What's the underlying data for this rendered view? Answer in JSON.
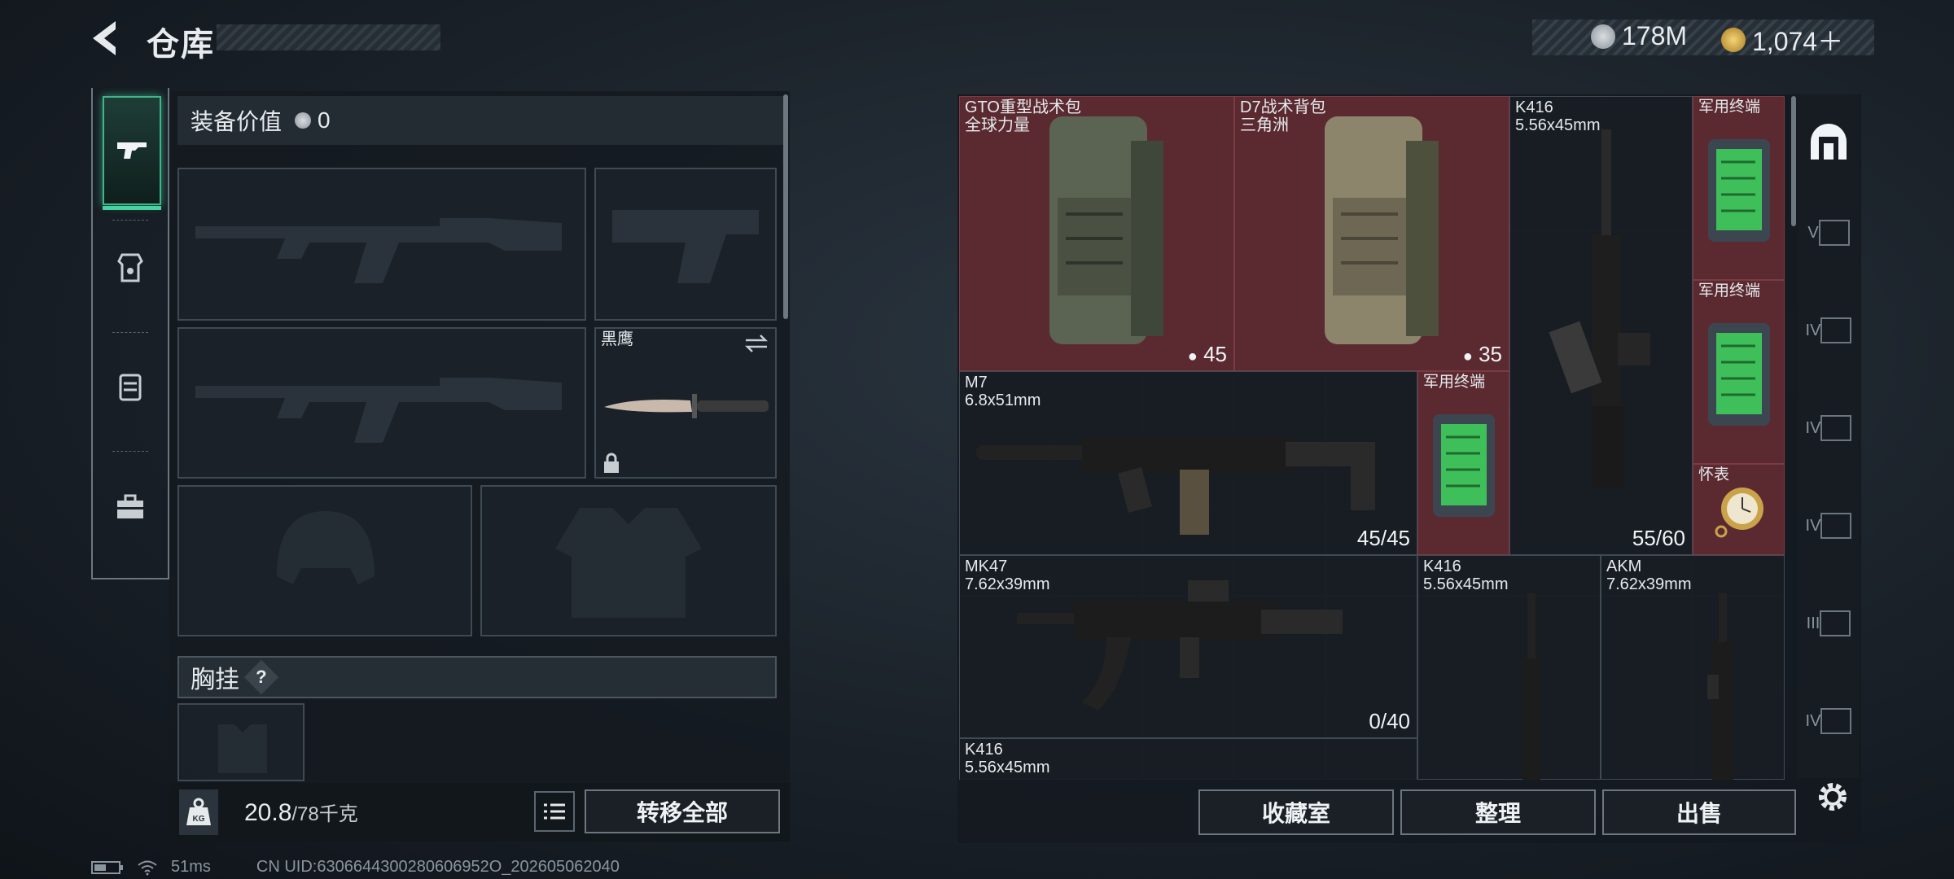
{
  "header": {
    "title": "仓库",
    "currency_silver": "178M",
    "currency_gold": "1,074＋"
  },
  "left_tabs": [
    {
      "name": "weapon-tab"
    },
    {
      "name": "armor-tab"
    },
    {
      "name": "backpack-tab"
    },
    {
      "name": "toolbox-tab"
    }
  ],
  "equipment": {
    "value_label": "装备价值",
    "value": "0",
    "secondary_slot_name": "黑鹰",
    "chest_label": "胸挂",
    "chest_help": "?"
  },
  "weight": {
    "current": "20.8",
    "max": "/78千克"
  },
  "buttons": {
    "transfer_all": "转移全部",
    "collection": "收藏室",
    "organize": "整理",
    "sell": "出售"
  },
  "status": {
    "ping": "51ms",
    "uid": "CN UID:6306644300280606952O_202605062040"
  },
  "storage_items": [
    {
      "name": "GTO重型战术包",
      "sub": "全球力量",
      "count": "45"
    },
    {
      "name": "D7战术背包",
      "sub": "三角洲",
      "count": "35"
    },
    {
      "name": "K416",
      "sub": "5.56x45mm",
      "count": "55/60"
    },
    {
      "name": "军用终端",
      "sub": ""
    },
    {
      "name": "军用终端",
      "sub": ""
    },
    {
      "name": "M7",
      "sub": "6.8x51mm",
      "count": "45/45"
    },
    {
      "name": "军用终端",
      "sub": ""
    },
    {
      "name": "怀表",
      "sub": ""
    },
    {
      "name": "MK47",
      "sub": "7.62x39mm",
      "count": "0/40"
    },
    {
      "name": "K416",
      "sub": "5.56x45mm"
    },
    {
      "name": "AKM",
      "sub": "7.62x39mm"
    },
    {
      "name": "K416",
      "sub": "5.56x45mm"
    }
  ],
  "right_tabs": [
    {
      "tier": "V"
    },
    {
      "tier": "IV"
    },
    {
      "tier": "IV"
    },
    {
      "tier": "IV"
    },
    {
      "tier": "III"
    },
    {
      "tier": "IV"
    }
  ],
  "colors": {
    "accent": "#47d3a1",
    "item_red": "#5b2a31",
    "terminal_green": "#3fbf5a"
  }
}
